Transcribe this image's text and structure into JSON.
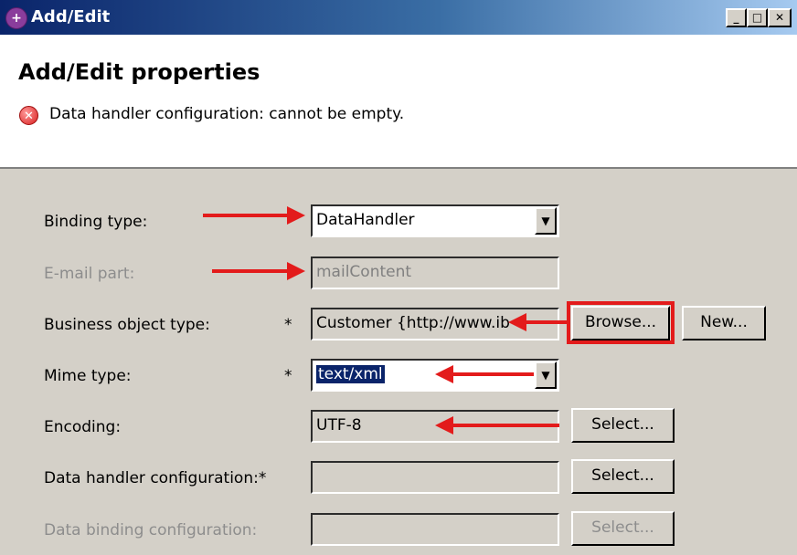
{
  "window": {
    "title": "Add/Edit",
    "title_icon": "app-icon",
    "minimize_glyph": "_",
    "maximize_glyph": "□",
    "close_glyph": "✕"
  },
  "header": {
    "title": "Add/Edit properties",
    "error_icon": "error-icon",
    "error_message": "Data handler configuration: cannot be empty."
  },
  "form": {
    "binding_type": {
      "label": "Binding type:",
      "value": "DataHandler"
    },
    "email_part": {
      "label": "E-mail part:",
      "value": "mailContent"
    },
    "business_object_type": {
      "label": "Business object type:",
      "required_mark": "*",
      "value": "Customer  {http://www.ib",
      "browse_label": "Browse...",
      "new_label": "New..."
    },
    "mime_type": {
      "label": "Mime type:",
      "required_mark": "*",
      "value": "text/xml"
    },
    "encoding": {
      "label": "Encoding:",
      "value": "UTF-8",
      "select_label": "Select..."
    },
    "data_handler_config": {
      "label": "Data handler configuration:*",
      "value": "",
      "select_label": "Select..."
    },
    "data_binding_config": {
      "label": "Data binding configuration:",
      "value": "",
      "select_label": "Select..."
    }
  },
  "colors": {
    "annotation_red": "#e31b1b",
    "titlebar_start": "#0a246a",
    "dialog_bg": "#d4d0c8",
    "selection_bg": "#0a246a"
  }
}
